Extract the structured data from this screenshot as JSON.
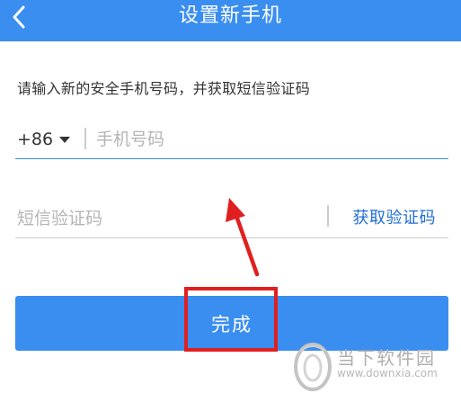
{
  "header": {
    "title": "设置新手机",
    "background_color": "#3a8ef0"
  },
  "instruction": "请输入新的安全手机号码，并获取短信验证码",
  "phone": {
    "country_code": "+86",
    "placeholder": "手机号码",
    "value": ""
  },
  "sms": {
    "placeholder": "短信验证码",
    "value": "",
    "get_code_label": "获取验证码",
    "link_color": "#1f6fd6"
  },
  "done_button": {
    "label": "完成"
  },
  "annotation": {
    "color": "#e02020"
  },
  "watermark": {
    "name": "当下软件园",
    "url": "www.downxia.com"
  }
}
